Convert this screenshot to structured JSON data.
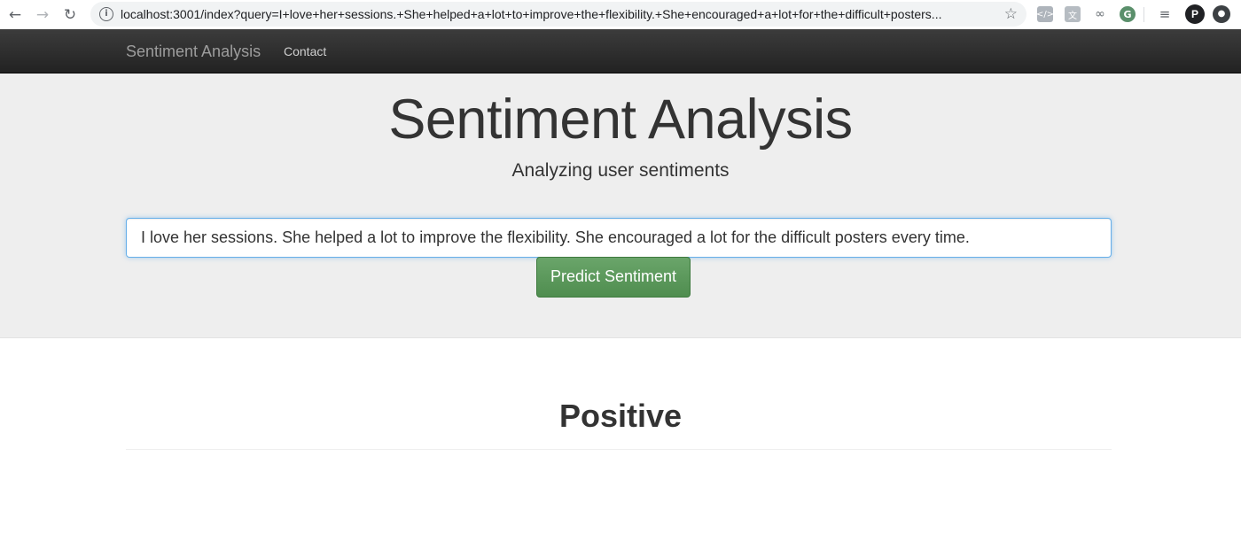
{
  "browser": {
    "url": "localhost:3001/index?query=I+love+her+sessions.+She+helped+a+lot+to+improve+the+flexibility.+She+encouraged+a+lot+for+the+difficult+posters...",
    "avatar_letter": "P",
    "icons": {
      "back": "back-arrow-icon",
      "forward": "forward-arrow-icon",
      "reload": "reload-icon",
      "info": "info-icon",
      "bookmark": "star-icon"
    }
  },
  "navbar": {
    "brand": "Sentiment Analysis",
    "links": [
      "Contact"
    ]
  },
  "hero": {
    "title": "Sentiment Analysis",
    "subtitle": "Analyzing user sentiments"
  },
  "form": {
    "query_value": "I love her sessions. She helped a lot to improve the flexibility. She encouraged a lot for the difficult posters every time.",
    "button_label": "Predict Sentiment"
  },
  "result": {
    "label": "Positive"
  },
  "colors": {
    "navbar_bg": "#222222",
    "jumbotron_bg": "#eeeeee",
    "button_green": "#5cb85c",
    "input_focus": "#66afe9"
  }
}
